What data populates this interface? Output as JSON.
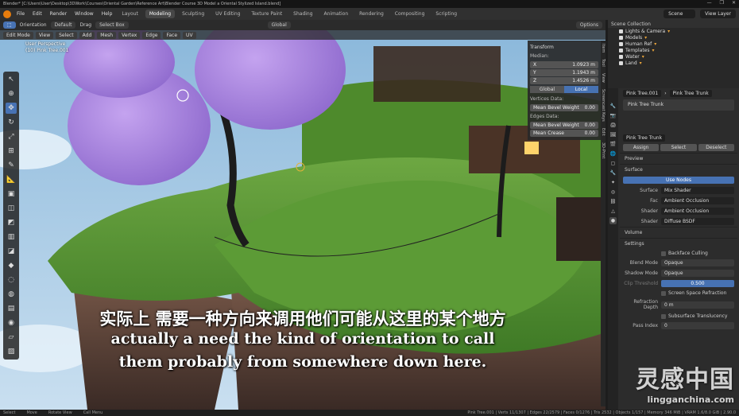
{
  "window": {
    "title": "Blender* [C:\\Users\\User\\Desktop\\3DWork\\Courses\\Oriental Garden\\Reference Art\\Blender Course 3D Model a Oriental Stylized Island.blend]",
    "controls": [
      "—",
      "❐",
      "✕"
    ]
  },
  "menubar": {
    "menus": [
      "File",
      "Edit",
      "Render",
      "Window",
      "Help"
    ],
    "workspaces": [
      "Layout",
      "Modeling",
      "Sculpting",
      "UV Editing",
      "Texture Paint",
      "Shading",
      "Animation",
      "Rendering",
      "Compositing",
      "Scripting"
    ],
    "active_workspace": "Modeling",
    "scene_label": "Scene",
    "view_layer_label": "View Layer"
  },
  "tool_header": {
    "orientation_label": "Orientation",
    "orientation_value": "Default",
    "drag_label": "Drag",
    "drag_value": "Select Box",
    "transform_orientation": "Global",
    "options_label": "Options"
  },
  "viewport_header": {
    "mode": "Edit Mode",
    "menus": [
      "View",
      "Select",
      "Add",
      "Mesh",
      "Vertex",
      "Edge",
      "Face",
      "UV"
    ]
  },
  "viewport_info": {
    "line1": "User Perspective",
    "line2": "(10) Pink Tree.001"
  },
  "npanel": {
    "section": "Transform",
    "median_label": "Median:",
    "x_label": "X",
    "x_value": "1.0923 m",
    "y_label": "Y",
    "y_value": "1.1943 m",
    "z_label": "Z",
    "z_value": "1.4526 m",
    "global_label": "Global",
    "local_label": "Local",
    "vertices_data": "Vertices Data:",
    "mean_bevel_weight_label": "Mean Bevel Weight",
    "mean_bevel_weight_value": "0.00",
    "edges_data": "Edges Data:",
    "edge_mean_bevel_weight_label": "Mean Bevel Weight",
    "edge_mean_bevel_weight_value": "0.00",
    "mean_crease_label": "Mean Crease",
    "mean_crease_value": "0.00"
  },
  "side_tabs": [
    "Item",
    "Tool",
    "View",
    "Screencast Keys",
    "Edit",
    "3D-Print"
  ],
  "subtitles": {
    "zh": "实际上 需要一种方向来调用他们可能从这里的某个地方",
    "en_line1": "actually a need the kind of orientation to call",
    "en_line2": "them probably from somewhere down here."
  },
  "outliner": {
    "header": "Scene Collection",
    "items": [
      "Lights & Camera",
      "Models",
      "Human Ref",
      "Templates",
      "Water",
      "Land"
    ]
  },
  "properties": {
    "object_name": "Pink Tree.001",
    "material_name": "Pink Tree Trunk",
    "slot_name": "Pink Tree Trunk",
    "assign_label": "Assign",
    "select_label": "Select",
    "deselect_label": "Deselect",
    "preview_label": "Preview",
    "surface_label": "Surface",
    "use_nodes_label": "Use Nodes",
    "surface_field_label": "Surface",
    "surface_value": "Mix Shader",
    "fac_label": "Fac",
    "fac_value": "Ambient Occlusion",
    "shader1_label": "Shader",
    "shader1_value": "Ambient Occlusion",
    "shader2_label": "Shader",
    "shader2_value": "Diffuse BSDF",
    "volume_label": "Volume",
    "settings_label": "Settings",
    "backface_culling": "Backface Culling",
    "blend_mode_label": "Blend Mode",
    "blend_mode_value": "Opaque",
    "shadow_mode_label": "Shadow Mode",
    "shadow_mode_value": "Opaque",
    "clip_threshold_label": "Clip Threshold",
    "clip_threshold_value": "0.500",
    "screen_space_refraction": "Screen Space Refraction",
    "refraction_depth_label": "Refraction Depth",
    "refraction_depth_value": "0 m",
    "subsurface_translucency": "Subsurface Translucency",
    "pass_index_label": "Pass Index",
    "pass_index_value": "0"
  },
  "watermark": {
    "zh": "灵感中国",
    "en": "lingganchina.com"
  },
  "statusbar": {
    "items": [
      "Select",
      "Move",
      "Rotate View",
      "Call Menu"
    ],
    "right": "Pink Tree.001 | Verts 11/1307 | Edges 22/2579 | Faces 0/1276 | Tris 2532 | Objects 1/157 | Memory 346 MiB | VRAM 1.6/8.0 GiB | 2.90.0"
  },
  "colors": {
    "accent_blue": "#4772b3",
    "blender_orange": "#e87d0d"
  }
}
